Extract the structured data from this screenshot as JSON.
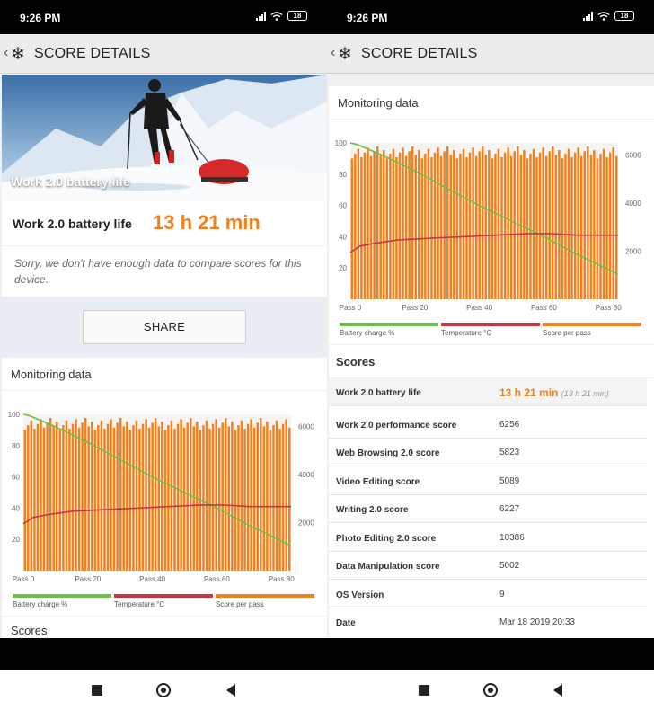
{
  "status": {
    "time": "9:26 PM",
    "battery": "18"
  },
  "appbar": {
    "title": "SCORE DETAILS"
  },
  "hero": {
    "caption": "Work 2.0 battery life"
  },
  "battery_life": {
    "label": "Work 2.0 battery life",
    "value": "13 h 21 min"
  },
  "compare_note": "Sorry, we don't have enough data to compare scores for this device.",
  "share_label": "SHARE",
  "monitoring": {
    "title": "Monitoring data",
    "legend": [
      {
        "label": "Battery charge %",
        "color": "#6cc04a"
      },
      {
        "label": "Temperature °C",
        "color": "#c8373f"
      },
      {
        "label": "Score per pass",
        "color": "#f2801b"
      }
    ]
  },
  "scores_title": "Scores",
  "scores": [
    {
      "key": "Work 2.0 battery life",
      "value": "13 h 21 min",
      "sub": "(13 h 21 min)"
    },
    {
      "key": "Work 2.0 performance score",
      "value": "6256"
    },
    {
      "key": "Web Browsing 2.0 score",
      "value": "5823"
    },
    {
      "key": "Video Editing score",
      "value": "5089"
    },
    {
      "key": "Writing 2.0 score",
      "value": "6227"
    },
    {
      "key": "Photo Editing 2.0 score",
      "value": "10386"
    },
    {
      "key": "Data Manipulation score",
      "value": "5002"
    },
    {
      "key": "OS Version",
      "value": "9"
    },
    {
      "key": "Date",
      "value": "Mar 18 2019 20:33"
    }
  ],
  "chart_data": {
    "type": "bar",
    "x_ticks": [
      "Pass 0",
      "Pass 20",
      "Pass 40",
      "Pass 60",
      "Pass 80"
    ],
    "y_left_ticks": [
      "100",
      "80",
      "60",
      "40",
      "20"
    ],
    "y_right_ticks": [
      "6000",
      "4000",
      "2000"
    ],
    "ylim_left": [
      0,
      100
    ],
    "ylim_right": [
      0,
      6500
    ],
    "passes": 84,
    "series": [
      {
        "name": "Score per pass",
        "axis": "right",
        "approx_value": 6100,
        "range": [
          5850,
          6350
        ]
      },
      {
        "name": "Battery charge %",
        "axis": "left",
        "points": [
          [
            0,
            100
          ],
          [
            2,
            99
          ],
          [
            10,
            92
          ],
          [
            20,
            82
          ],
          [
            30,
            71
          ],
          [
            40,
            60
          ],
          [
            50,
            50
          ],
          [
            60,
            40
          ],
          [
            70,
            29
          ],
          [
            80,
            19
          ],
          [
            83,
            16
          ]
        ]
      },
      {
        "name": "Temperature °C",
        "axis": "left",
        "points": [
          [
            0,
            30
          ],
          [
            3,
            34
          ],
          [
            8,
            36
          ],
          [
            15,
            38
          ],
          [
            25,
            39
          ],
          [
            35,
            40
          ],
          [
            45,
            41
          ],
          [
            55,
            42
          ],
          [
            62,
            42
          ],
          [
            70,
            41
          ],
          [
            83,
            41
          ]
        ]
      }
    ],
    "grid": false,
    "legend_position": "bottom"
  }
}
